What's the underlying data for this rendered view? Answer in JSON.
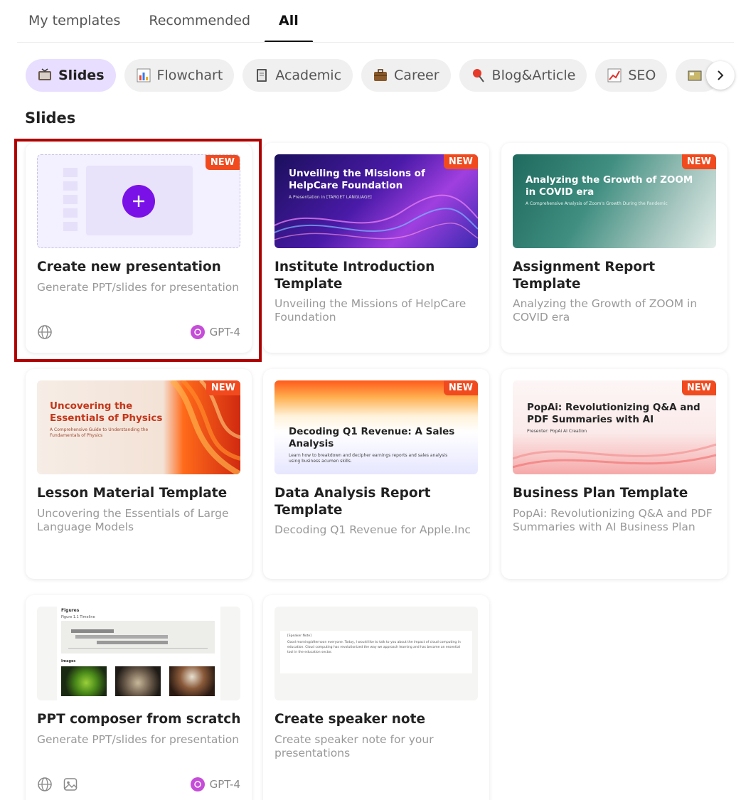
{
  "tabs": [
    {
      "label": "My templates",
      "active": false
    },
    {
      "label": "Recommended",
      "active": false
    },
    {
      "label": "All",
      "active": true
    }
  ],
  "chips": [
    {
      "label": "Slides",
      "icon": "presentation-icon",
      "active": true
    },
    {
      "label": "Flowchart",
      "icon": "bar-chart-icon",
      "active": false
    },
    {
      "label": "Academic",
      "icon": "notebook-icon",
      "active": false
    },
    {
      "label": "Career",
      "icon": "briefcase-icon",
      "active": false
    },
    {
      "label": "Blog&Article",
      "icon": "pin-icon",
      "active": false
    },
    {
      "label": "SEO",
      "icon": "line-chart-icon",
      "active": false
    }
  ],
  "section_title": "Slides",
  "badge_label": "NEW",
  "cards": [
    {
      "title": "Create new presentation",
      "desc": "Generate PPT/slides for presentation",
      "model": "GPT-4"
    },
    {
      "title": "Institute Introduction Template",
      "desc": "Unveiling the Missions of HelpCare Foundation",
      "thumb_title": "Unveiling the Missions of HelpCare Foundation",
      "thumb_sub": "A Presentation in [TARGET LANGUAGE]"
    },
    {
      "title": "Assignment Report Template",
      "desc": "Analyzing the Growth of ZOOM in COVID era",
      "thumb_title": "Analyzing the Growth of ZOOM in COVID era",
      "thumb_sub": "A Comprehensive Analysis of Zoom's Growth During the Pandemic"
    },
    {
      "title": "Lesson Material Template",
      "desc": "Uncovering the Essentials of Large Language Models",
      "thumb_title": "Uncovering the Essentials of Physics",
      "thumb_sub": "A Comprehensive Guide to Understanding the Fundamentals of Physics"
    },
    {
      "title": "Data Analysis Report Template",
      "desc": "Decoding Q1 Revenue for Apple.Inc",
      "thumb_title": "Decoding Q1 Revenue: A Sales Analysis",
      "thumb_sub": "Learn how to breakdown and decipher earnings reports and sales analysis using business acumen skills."
    },
    {
      "title": "Business Plan Template",
      "desc": "PopAi: Revolutionizing Q&A and PDF Summaries with AI Business Plan",
      "thumb_title": "PopAi: Revolutionizing Q&A and PDF Summaries with AI",
      "thumb_sub": "Presenter: PopAi AI Creation"
    },
    {
      "title": "PPT composer from scratch",
      "desc": "Generate PPT/slides for presentation",
      "model": "GPT-4",
      "thumb_heading": "Figures",
      "thumb_caption": "Figure 1.1 Timeline",
      "thumb_images_label": "Images"
    },
    {
      "title": "Create speaker note",
      "desc": "Create speaker note for your presentations",
      "thumb_note_label": "[Speaker Note]",
      "thumb_note_text": "Good morning/afternoon everyone. Today, I would like to talk to you about the impact of cloud computing in education. Cloud computing has revolutionized the way we approach learning and has become an essential tool in the education sector."
    }
  ]
}
